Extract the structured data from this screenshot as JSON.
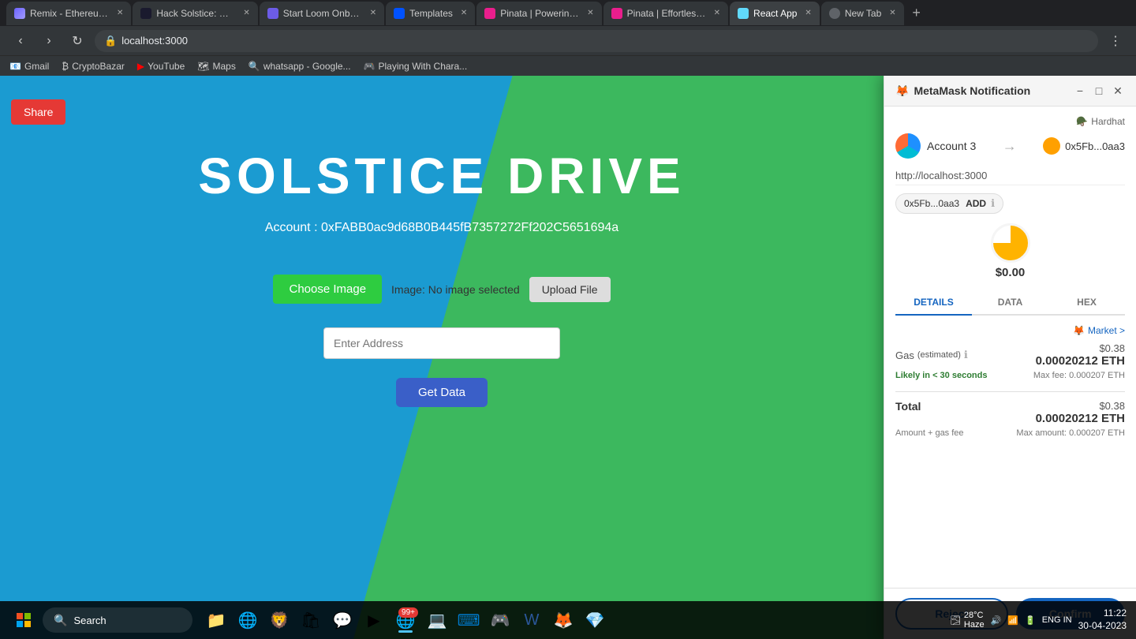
{
  "browser": {
    "address": "localhost:3000",
    "tabs": [
      {
        "id": "remix",
        "label": "Remix - Ethereum...",
        "favicon_class": "fav-remix",
        "active": false
      },
      {
        "id": "hack",
        "label": "Hack Solstice: Da...",
        "favicon_class": "fav-hack",
        "active": false
      },
      {
        "id": "loom",
        "label": "Start Loom Onbo...",
        "favicon_class": "fav-loom",
        "active": false
      },
      {
        "id": "coinbase",
        "label": "Templates",
        "favicon_class": "fav-coinbase",
        "active": false
      },
      {
        "id": "pinata1",
        "label": "Pinata | Powering...",
        "favicon_class": "fav-pinata",
        "active": false
      },
      {
        "id": "pinata2",
        "label": "Pinata | Effortless...",
        "favicon_class": "fav-pinata2",
        "active": false
      },
      {
        "id": "react",
        "label": "React App",
        "favicon_class": "fav-react",
        "active": true
      },
      {
        "id": "newtab",
        "label": "New Tab",
        "favicon_class": "fav-new",
        "active": false
      }
    ],
    "bookmarks": [
      {
        "label": "Gmail",
        "favicon": "📧"
      },
      {
        "label": "CryptoBazar",
        "favicon": "₿"
      },
      {
        "label": "YouTube",
        "favicon": "▶"
      },
      {
        "label": "Maps",
        "favicon": "🗺"
      },
      {
        "label": "whatsapp - Google...",
        "favicon": "🔍"
      },
      {
        "label": "Playing With Chara...",
        "favicon": "🎮"
      }
    ]
  },
  "app": {
    "title": "SOLSTICE DRIVE",
    "share_label": "Share",
    "account_label": "Account :",
    "account_address": "0xFABB0ac9d68B0B445fB7357272Ff202C5651694a",
    "choose_image_label": "Choose Image",
    "image_status": "Image: No image selected",
    "upload_file_label": "Upload File",
    "enter_address_placeholder": "Enter Address",
    "get_data_label": "Get Data"
  },
  "metamask": {
    "title": "MetaMask Notification",
    "hardhat_label": "Hardhat",
    "account_name": "Account 3",
    "account_address_short": "0x5Fb...0aa3",
    "site_url": "http://localhost:3000",
    "from_address": "0x5Fb...0aa3",
    "add_label": "ADD",
    "balance": "$0.00",
    "tabs": [
      "DETAILS",
      "DATA",
      "HEX"
    ],
    "active_tab": "DETAILS",
    "market_label": "Market >",
    "gas_label": "Gas",
    "gas_estimated": "(estimated)",
    "gas_usd": "$0.38",
    "gas_eth": "0.00020212 ETH",
    "likely_label": "Likely in < 30 seconds",
    "max_fee_label": "Max fee:",
    "max_fee_value": "0.000207 ETH",
    "total_label": "Total",
    "total_usd": "$0.38",
    "total_eth": "0.00020212 ETH",
    "amount_gas_label": "Amount + gas fee",
    "max_amount_label": "Max amount:",
    "max_amount_value": "0.000207 ETH",
    "reject_label": "Reject",
    "confirm_label": "Confirm"
  },
  "taskbar": {
    "search_placeholder": "Search",
    "weather_temp": "28°C",
    "weather_condition": "Haze",
    "time": "11:22",
    "date": "30-04-2023",
    "lang": "ENG\nIN",
    "notification_badge": "99+"
  }
}
